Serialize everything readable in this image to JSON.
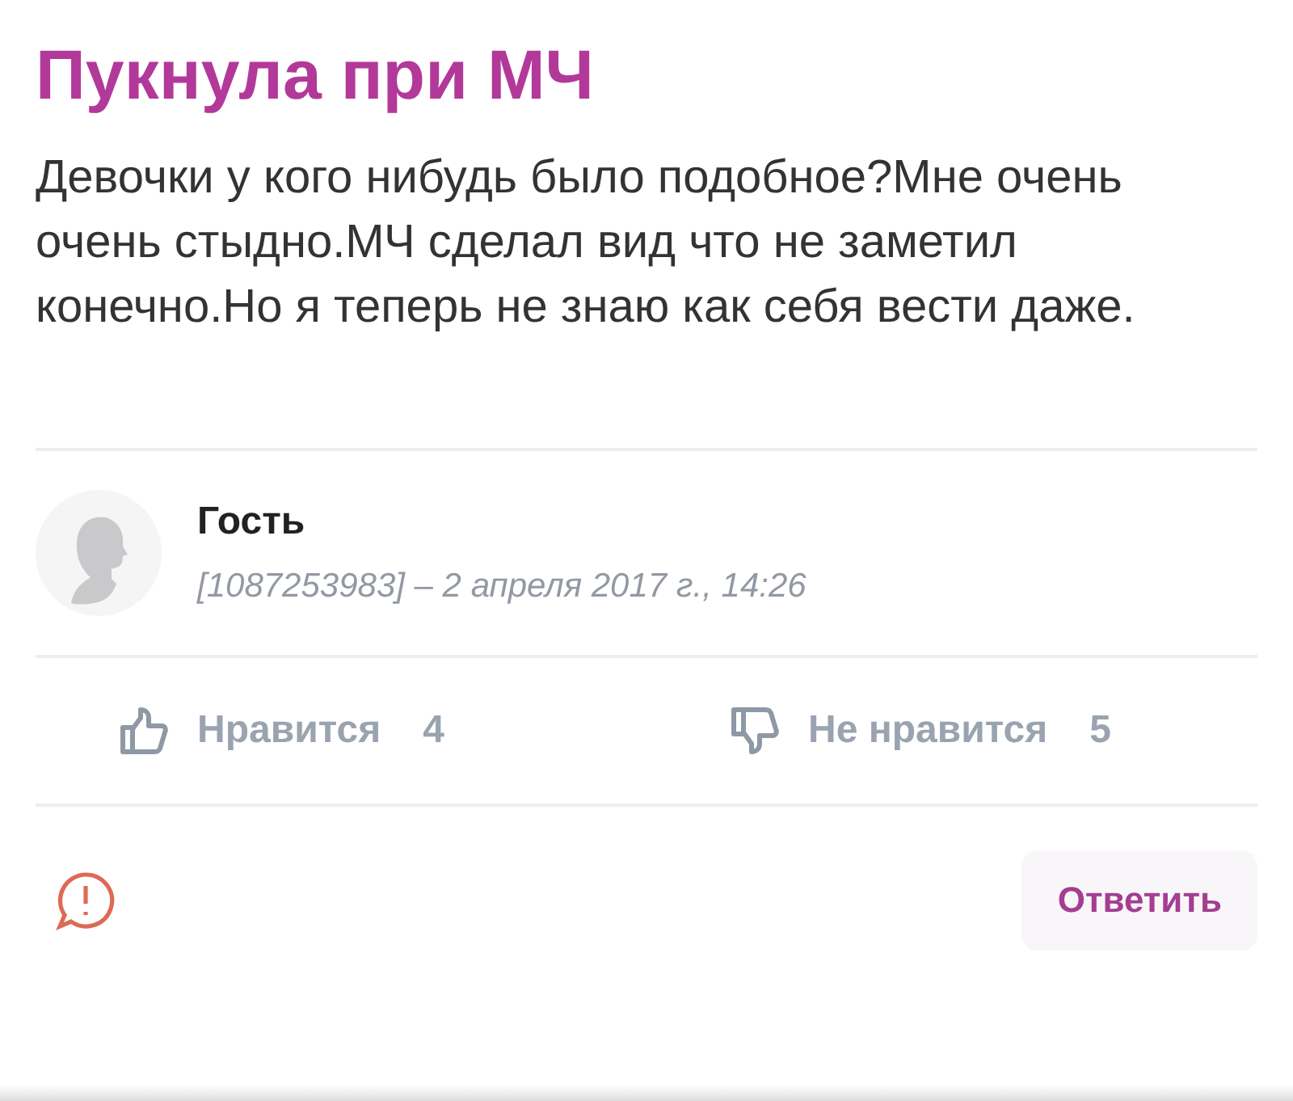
{
  "post": {
    "title": "Пукнула при МЧ",
    "body": "Девочки у кого нибудь было подобное?Мне очень очень стыдно.МЧ сделал вид что не заметил конечно.Но я теперь не знаю как себя вести даже."
  },
  "author": {
    "name": "Гость",
    "meta": "[1087253983] – 2 апреля 2017 г., 14:26"
  },
  "reactions": [
    {
      "kind": "like",
      "label": "Нравится",
      "count": "4"
    },
    {
      "kind": "dislike",
      "label": "Не нравится",
      "count": "5"
    }
  ],
  "reply_button": "Ответить"
}
